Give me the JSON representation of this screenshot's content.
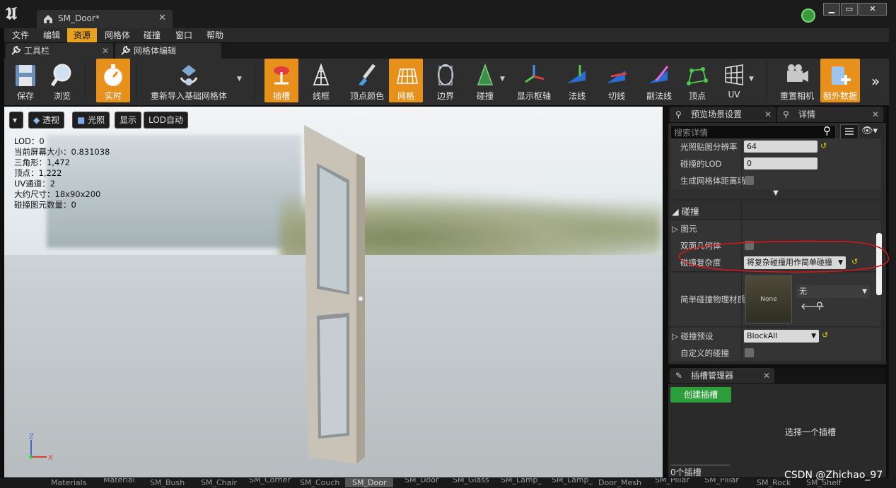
{
  "titlebar": {
    "tab_title": "SM_Door*"
  },
  "menu": [
    "文件",
    "编辑",
    "资源",
    "网格体",
    "碰撞",
    "窗口",
    "帮助"
  ],
  "panel_tabs": {
    "toolbar": "工具栏",
    "mesh_edit": "网格体编辑"
  },
  "toolbar": {
    "save": "保存",
    "browse": "浏览",
    "realtime": "实时",
    "reimport": "重新导入基础网格体",
    "sockets": "插槽",
    "wireframe": "线框",
    "vertex_color": "顶点颜色",
    "grid": "网格",
    "bounds": "边界",
    "collision": "碰撞",
    "show_pivot": "显示枢轴",
    "normals": "法线",
    "tangents": "切线",
    "binormals": "副法线",
    "vertices": "顶点",
    "uv": "UV",
    "reset_camera": "重置相机",
    "additional_data": "额外数据"
  },
  "viewport": {
    "perspective": "透视",
    "lit": "光照",
    "show": "显示",
    "lod_auto": "LOD自动",
    "stats": [
      "LOD：0",
      "当前屏幕大小：0.831038",
      "三角形：1,472",
      "顶点：1,222",
      "UV通道：2",
      "大约尺寸：18x90x200",
      "碰撞图元数量：0"
    ],
    "axis": {
      "z": "Z",
      "x": "X"
    }
  },
  "details": {
    "tab_preview": "预览场景设置",
    "tab_details": "详情",
    "search_placeholder": "搜索详情",
    "lightmap_res_label": "光照贴图分辨率",
    "lightmap_res_value": "64",
    "collision_lod_label": "碰撞的LOD",
    "collision_lod_value": "0",
    "gen_distance_label": "生成网格体距离场",
    "section_collision": "碰撞",
    "primitives": "图元",
    "double_sided": "双面几何体",
    "complexity_label": "碰撞复杂度",
    "complexity_value": "将复杂碰撞用作简单碰撞",
    "phys_mat_label": "简单碰撞物理材质",
    "phys_mat_thumb": "None",
    "phys_mat_value": "无",
    "preset_label": "碰撞预设",
    "preset_value": "BlockAll",
    "custom_label": "自定义的碰撞"
  },
  "socket_manager": {
    "title": "插槽管理器",
    "create": "创建插槽",
    "hint": "选择一个插槽",
    "count": "0个插槽"
  },
  "bottom_tabs": [
    "Materials",
    "Material",
    "SM_Bush",
    "SM_Chair",
    "SM_Corner",
    "SM_Couch",
    "SM_Door",
    "SM_Door",
    "SM_Glass",
    "SM_Lamp_",
    "SM_Lamp_",
    "Door_Mesh",
    "SM_Pillar",
    "SM_Pillar",
    "SM_Rock",
    "SM_Shelf"
  ],
  "watermark": "CSDN @Zhichao_97",
  "colors": {
    "accent": "#e8901c",
    "menu_active": "#e6a11e",
    "create_button": "#2c9e3a",
    "annotation": "#d81818"
  }
}
